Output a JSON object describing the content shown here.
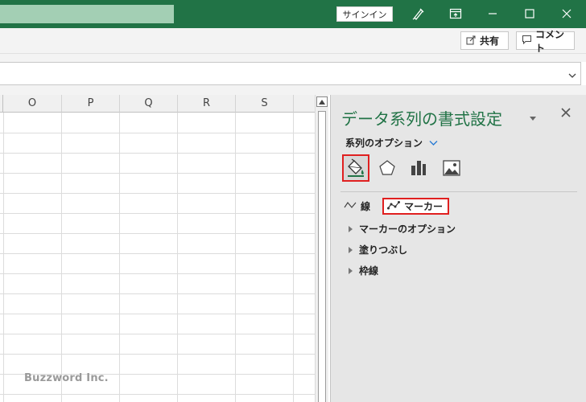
{
  "titlebar": {
    "signin_label": "サインイン",
    "icons": [
      "pen-icon",
      "ribbon-display-icon",
      "minimize-icon",
      "maximize-icon",
      "close-icon"
    ]
  },
  "ribbon": {
    "share_label": "共有",
    "comment_label": "コメント"
  },
  "grid": {
    "columns": [
      "O",
      "P",
      "Q",
      "R",
      "S"
    ],
    "watermark": "Buzzword Inc."
  },
  "pane": {
    "title": "データ系列の書式設定",
    "series_options_label": "系列のオプション",
    "icon_tabs": [
      "fill-line-icon",
      "effects-icon",
      "series-options-icon",
      "picture-icon"
    ],
    "subtabs": {
      "line": "線",
      "marker": "マーカー"
    },
    "sections": [
      "マーカーのオプション",
      "塗りつぶし",
      "枠線"
    ]
  },
  "colors": {
    "accent": "#217346",
    "highlight": "#e02020"
  }
}
